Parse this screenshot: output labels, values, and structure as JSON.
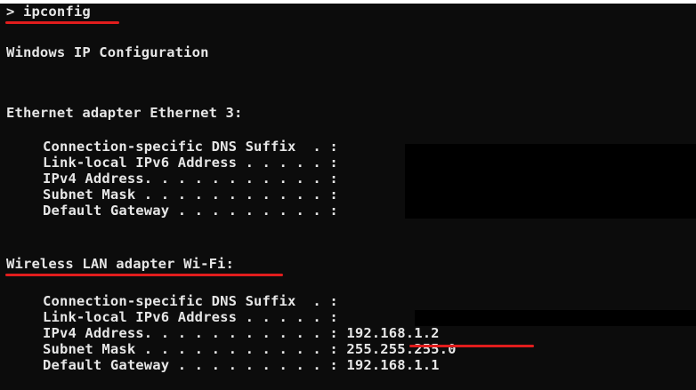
{
  "terminal": {
    "prompt_command": "> ipconfig",
    "title_line": "Windows IP Configuration",
    "adapters": [
      {
        "heading": "Ethernet adapter Ethernet 3:",
        "rows": [
          {
            "label": "Connection-specific DNS Suffix  . :",
            "value": ""
          },
          {
            "label": "Link-local IPv6 Address . . . . . :",
            "value": ""
          },
          {
            "label": "IPv4 Address. . . . . . . . . . . :",
            "value": ""
          },
          {
            "label": "Subnet Mask . . . . . . . . . . . :",
            "value": ""
          },
          {
            "label": "Default Gateway . . . . . . . . . :",
            "value": ""
          }
        ]
      },
      {
        "heading": "Wireless LAN adapter Wi-Fi:",
        "rows": [
          {
            "label": "Connection-specific DNS Suffix  . :",
            "value": ""
          },
          {
            "label": "Link-local IPv6 Address . . . . . :",
            "value": ""
          },
          {
            "label": "IPv4 Address. . . . . . . . . . . :",
            "value": "192.168.1.2"
          },
          {
            "label": "Subnet Mask . . . . . . . . . . . :",
            "value": "255.255.255.0"
          },
          {
            "label": "Default Gateway . . . . . . . . . :",
            "value": "192.168.1.1"
          }
        ]
      }
    ]
  },
  "colors": {
    "background": "#0c0c0c",
    "text": "#e6e6e6",
    "annotation": "#e11d1d"
  }
}
